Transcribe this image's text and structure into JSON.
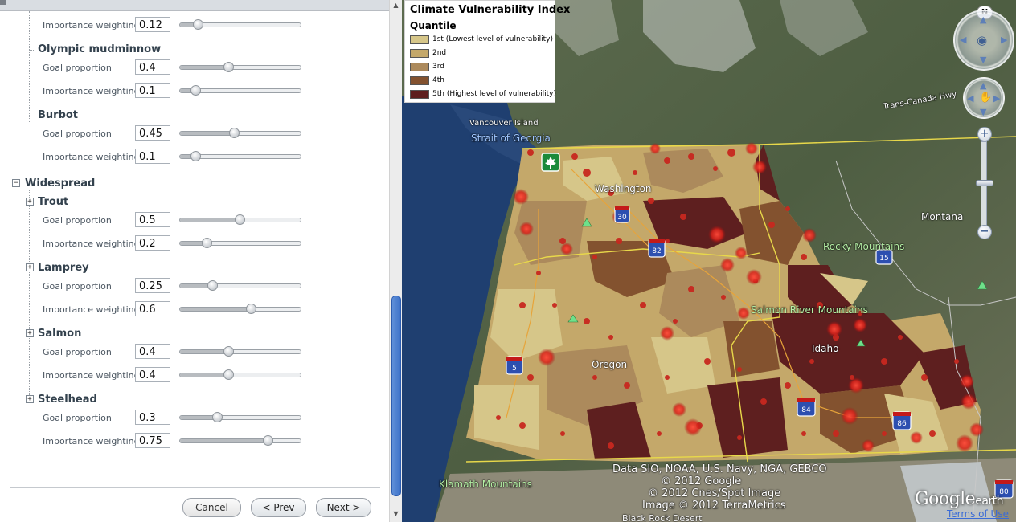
{
  "panel": {
    "top_item": {
      "label": "Importance weighting",
      "value": "0.12",
      "slider": 0.12
    },
    "groups": [
      {
        "name": "Olympic mudminnow",
        "params": [
          {
            "label": "Goal proportion",
            "value": "0.4",
            "slider": 0.4
          },
          {
            "label": "Importance weighting",
            "value": "0.1",
            "slider": 0.1
          }
        ]
      },
      {
        "name": "Burbot",
        "params": [
          {
            "label": "Goal proportion",
            "value": "0.45",
            "slider": 0.45
          },
          {
            "label": "Importance weighting",
            "value": "0.1",
            "slider": 0.1
          }
        ]
      }
    ],
    "category": {
      "name": "Widespread",
      "expander": "−",
      "groups": [
        {
          "name": "Trout",
          "expander": "+",
          "params": [
            {
              "label": "Goal proportion",
              "value": "0.5",
              "slider": 0.5
            },
            {
              "label": "Importance weighting",
              "value": "0.2",
              "slider": 0.2
            }
          ]
        },
        {
          "name": "Lamprey",
          "expander": "+",
          "params": [
            {
              "label": "Goal proportion",
              "value": "0.25",
              "slider": 0.25
            },
            {
              "label": "Importance weighting",
              "value": "0.6",
              "slider": 0.6
            }
          ]
        },
        {
          "name": "Salmon",
          "expander": "+",
          "params": [
            {
              "label": "Goal proportion",
              "value": "0.4",
              "slider": 0.4
            },
            {
              "label": "Importance weighting",
              "value": "0.4",
              "slider": 0.4
            }
          ]
        },
        {
          "name": "Steelhead",
          "expander": "+",
          "params": [
            {
              "label": "Goal proportion",
              "value": "0.3",
              "slider": 0.3
            },
            {
              "label": "Importance weighting",
              "value": "0.75",
              "slider": 0.75
            }
          ]
        }
      ]
    },
    "buttons": {
      "cancel": "Cancel",
      "prev": "< Prev",
      "next": "Next >"
    }
  },
  "legend": {
    "title": "Climate Vulnerability Index",
    "subtitle": "Quantile",
    "items": [
      {
        "label": "1st (Lowest level of vulnerability)",
        "color": "#d6c689"
      },
      {
        "label": "2nd",
        "color": "#c4a86a"
      },
      {
        "label": "3rd",
        "color": "#ac8a5c"
      },
      {
        "label": "4th",
        "color": "#83522f"
      },
      {
        "label": "5th (Highest level of vulnerability)",
        "color": "#5e1f1f"
      }
    ]
  },
  "map": {
    "labels": {
      "vancouver_island": "Vancouver Island",
      "strait_of_georgia": "Strait of Georgia",
      "washington": "Washington",
      "oregon": "Oregon",
      "idaho": "Idaho",
      "montana": "Montana",
      "rocky_mountains": "Rocky Mountains",
      "salmon_river_mountains": "Salmon River Mountains",
      "klamath_mountains": "Klamath Mountains",
      "trans_canada": "Trans-Canada Hwy",
      "black_rock_desert": "Black Rock Desert"
    },
    "highways": [
      "30",
      "82",
      "15",
      "5",
      "84",
      "86",
      "80"
    ],
    "attribution": [
      "Data SIO, NOAA, U.S. Navy, NGA, GEBCO",
      "© 2012 Google",
      "© 2012 Cnes/Spot Image",
      "Image © 2012 TerraMetrics"
    ],
    "logo_main": "Google",
    "logo_suffix": "earth",
    "terms": "Terms of Use",
    "north": "N",
    "zoom_in": "+",
    "zoom_out": "−"
  }
}
